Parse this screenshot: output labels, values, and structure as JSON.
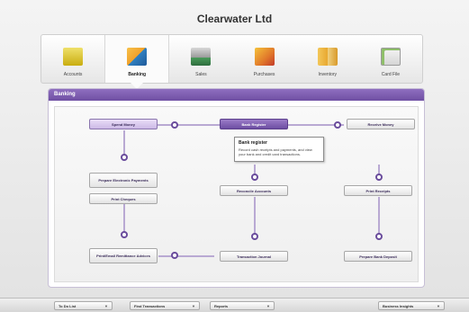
{
  "window": {
    "title": "Clearwater Ltd"
  },
  "command_centres": [
    {
      "label": "Accounts",
      "icon": "accounts-icon",
      "color": "#d9c21f"
    },
    {
      "label": "Banking",
      "icon": "banking-icon",
      "color": "#f0a02a",
      "active": true
    },
    {
      "label": "Sales",
      "icon": "sales-icon",
      "color": "#4a9a5a"
    },
    {
      "label": "Purchases",
      "icon": "purchases-icon",
      "color": "#e0762a"
    },
    {
      "label": "Inventory",
      "icon": "inventory-icon",
      "color": "#e8a830"
    },
    {
      "label": "Card File",
      "icon": "card-file-icon",
      "color": "#8fbf6a"
    }
  ],
  "panel": {
    "header": "Banking",
    "buttons": {
      "spend_money": "Spend Money",
      "bank_register": "Bank Register",
      "receive_money": "Receive Money",
      "prepare_electronic_payments": "Prepare Electronic Payments",
      "print_cheques": "Print Cheques",
      "reconcile_accounts": "Reconcile Accounts",
      "print_receipts": "Print Receipts",
      "print_email_remittance": "Print/Email Remittance Advices",
      "transaction_journal": "Transaction Journal",
      "prepare_bank_deposit": "Prepare Bank Deposit"
    },
    "tooltip": {
      "title": "Bank register",
      "body": "Record cash receipts and payments, and view your bank and credit card transactions."
    }
  },
  "bottom_bar": {
    "todo": "To Do List",
    "find_transactions": "Find Transactions",
    "reports": "Reports",
    "business_insights": "Business Insights"
  },
  "colors": {
    "accent": "#6f4fa3",
    "panel_header": "#7a5ab0"
  }
}
